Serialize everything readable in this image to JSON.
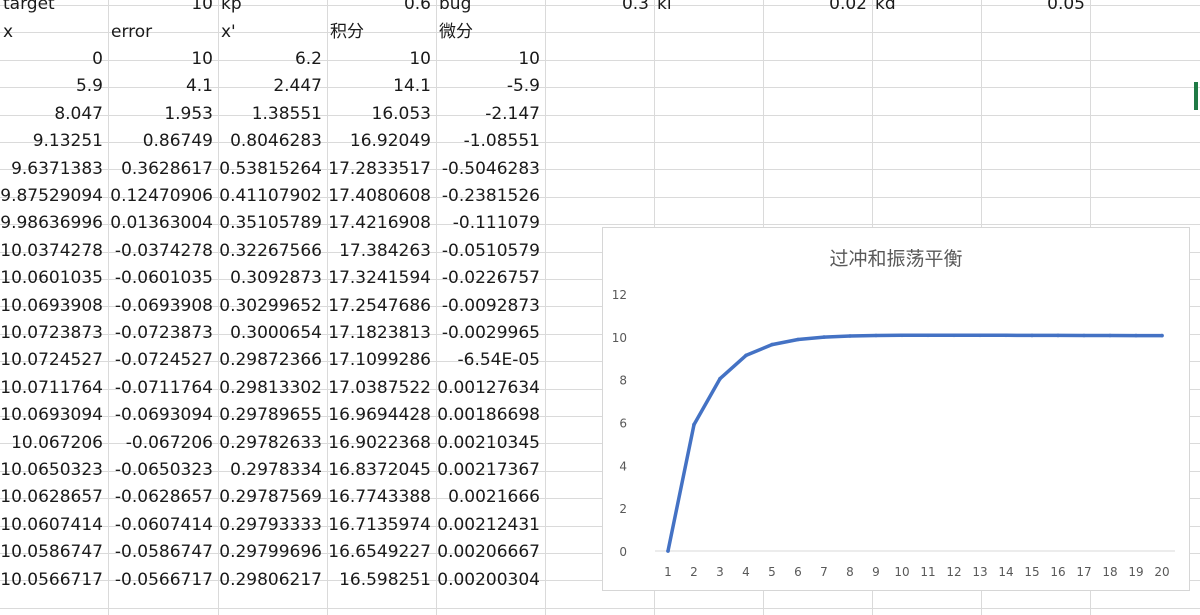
{
  "params": [
    {
      "label": "target",
      "value": "10"
    },
    {
      "label": "kp",
      "value": "0.6"
    },
    {
      "label": "bug",
      "value": "0.3"
    },
    {
      "label": "ki",
      "value": "0.02"
    },
    {
      "label": "kd",
      "value": "0.05"
    }
  ],
  "headers": [
    "x",
    "error",
    "x'",
    "积分",
    "微分"
  ],
  "rows": [
    [
      "0",
      "10",
      "6.2",
      "10",
      "10"
    ],
    [
      "5.9",
      "4.1",
      "2.447",
      "14.1",
      "-5.9"
    ],
    [
      "8.047",
      "1.953",
      "1.38551",
      "16.053",
      "-2.147"
    ],
    [
      "9.13251",
      "0.86749",
      "0.8046283",
      "16.92049",
      "-1.08551"
    ],
    [
      "9.6371383",
      "0.3628617",
      "0.53815264",
      "17.2833517",
      "-0.5046283"
    ],
    [
      "9.87529094",
      "0.12470906",
      "0.41107902",
      "17.4080608",
      "-0.2381526"
    ],
    [
      "9.98636996",
      "0.01363004",
      "0.35105789",
      "17.4216908",
      "-0.111079"
    ],
    [
      "10.0374278",
      "-0.0374278",
      "0.32267566",
      "17.384263",
      "-0.0510579"
    ],
    [
      "10.0601035",
      "-0.0601035",
      "0.3092873",
      "17.3241594",
      "-0.0226757"
    ],
    [
      "10.0693908",
      "-0.0693908",
      "0.30299652",
      "17.2547686",
      "-0.0092873"
    ],
    [
      "10.0723873",
      "-0.0723873",
      "0.3000654",
      "17.1823813",
      "-0.0029965"
    ],
    [
      "10.0724527",
      "-0.0724527",
      "0.29872366",
      "17.1099286",
      "-6.54E-05"
    ],
    [
      "10.0711764",
      "-0.0711764",
      "0.29813302",
      "17.0387522",
      "0.00127634"
    ],
    [
      "10.0693094",
      "-0.0693094",
      "0.29789655",
      "16.9694428",
      "0.00186698"
    ],
    [
      "10.067206",
      "-0.067206",
      "0.29782633",
      "16.9022368",
      "0.00210345"
    ],
    [
      "10.0650323",
      "-0.0650323",
      "0.2978334",
      "16.8372045",
      "0.00217367"
    ],
    [
      "10.0628657",
      "-0.0628657",
      "0.29787569",
      "16.7743388",
      "0.0021666"
    ],
    [
      "10.0607414",
      "-0.0607414",
      "0.29793333",
      "16.7135974",
      "0.00212431"
    ],
    [
      "10.0586747",
      "-0.0586747",
      "0.29799696",
      "16.6549227",
      "0.00206667"
    ],
    [
      "10.0566717",
      "-0.0566717",
      "0.29806217",
      "16.598251",
      "0.00200304"
    ]
  ],
  "chart_data": {
    "type": "line",
    "title": "过冲和振荡平衡",
    "x": [
      1,
      2,
      3,
      4,
      5,
      6,
      7,
      8,
      9,
      10,
      11,
      12,
      13,
      14,
      15,
      16,
      17,
      18,
      19,
      20
    ],
    "series": [
      {
        "values": [
          0,
          5.9,
          8.047,
          9.13251,
          9.6371383,
          9.87529094,
          9.98636996,
          10.0374278,
          10.0601035,
          10.0693908,
          10.0723873,
          10.0724527,
          10.0711764,
          10.0693094,
          10.067206,
          10.0650323,
          10.0628657,
          10.0607414,
          10.0586747,
          10.0566717
        ]
      }
    ],
    "ylim": [
      0,
      12
    ],
    "yticks": [
      0,
      2,
      4,
      6,
      8,
      10,
      12
    ],
    "grid": false,
    "legend": "none",
    "line_color": "#4472c4"
  }
}
